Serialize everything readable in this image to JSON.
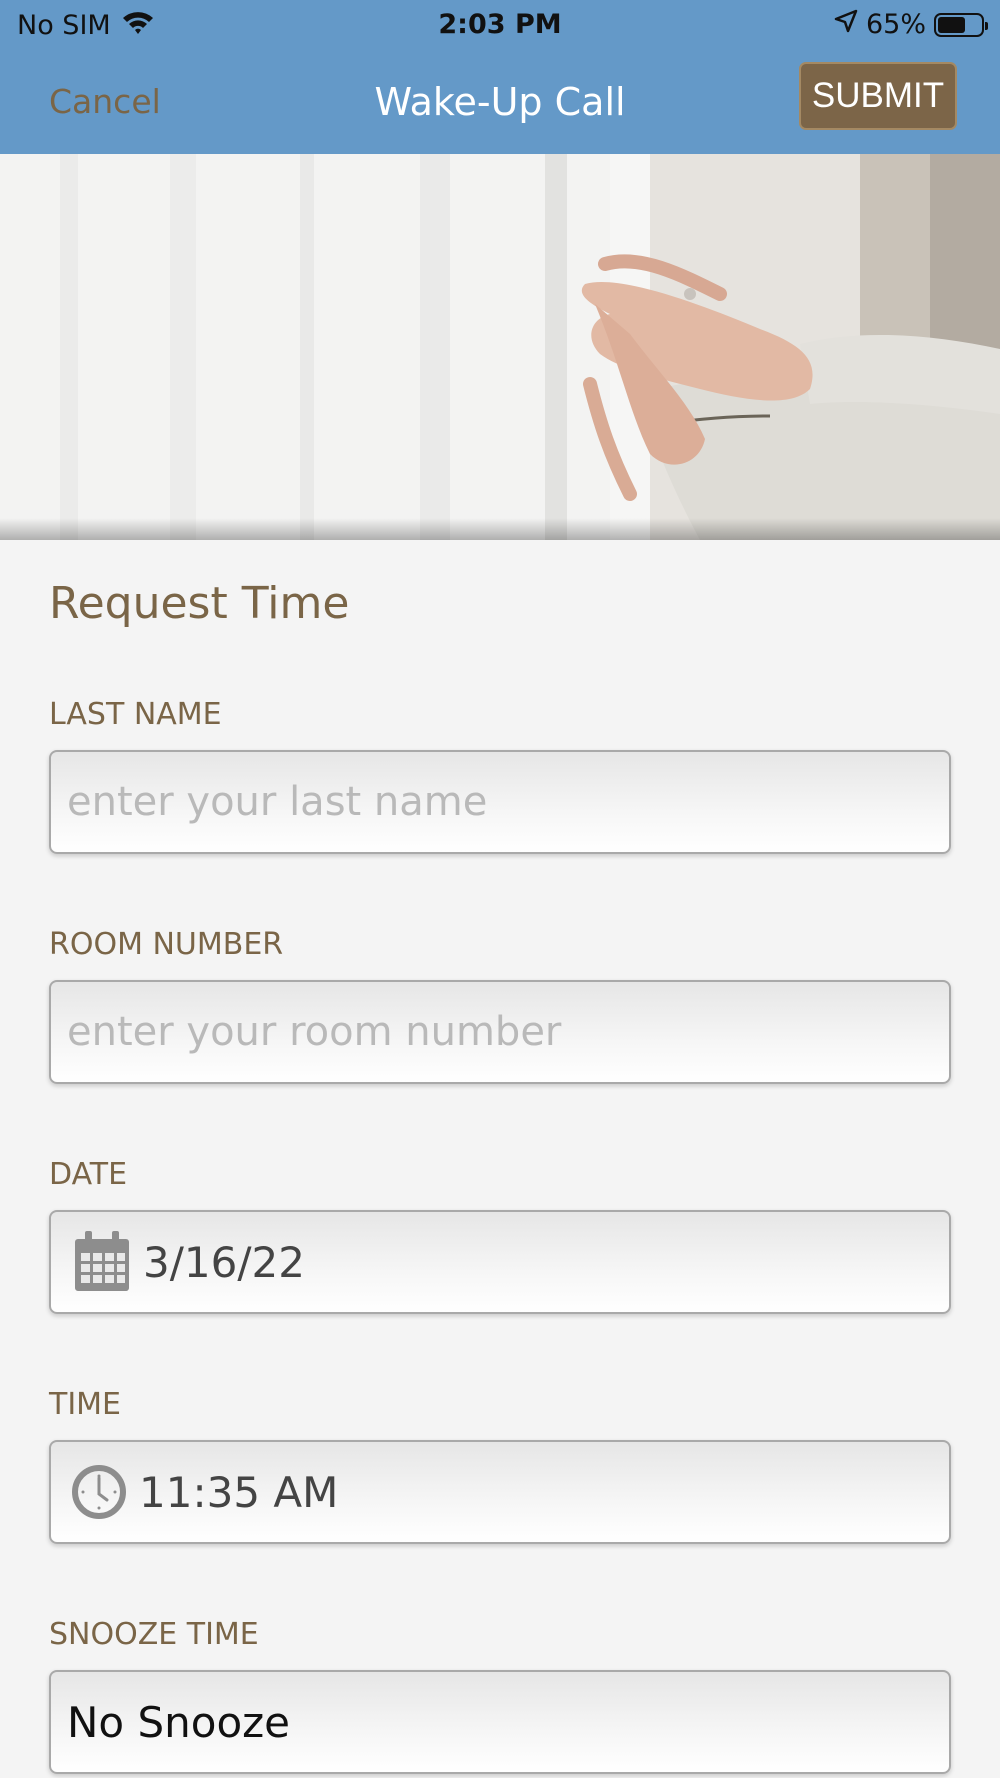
{
  "status_bar": {
    "carrier": "No SIM",
    "time": "2:03 PM",
    "battery": "65%",
    "battery_level": 0.65
  },
  "nav": {
    "cancel_label": "Cancel",
    "title": "Wake-Up Call",
    "submit_label": "SUBMIT"
  },
  "hero": {
    "icon": "hands-curtain-photo"
  },
  "form": {
    "section_title": "Request Time",
    "last_name": {
      "label": "LAST NAME",
      "placeholder": "enter your last name",
      "value": ""
    },
    "room_number": {
      "label": "ROOM NUMBER",
      "placeholder": "enter your room number",
      "value": ""
    },
    "date": {
      "label": "DATE",
      "value": "3/16/22",
      "icon": "calendar-icon"
    },
    "time": {
      "label": "TIME",
      "value": "11:35 AM",
      "icon": "clock-icon"
    },
    "snooze": {
      "label": "SNOOZE TIME",
      "value": "No Snooze"
    }
  },
  "colors": {
    "nav_background": "#6499c8",
    "accent_brown": "#7a6547",
    "submit_background": "#7c6548",
    "page_background": "#f4f4f4"
  }
}
